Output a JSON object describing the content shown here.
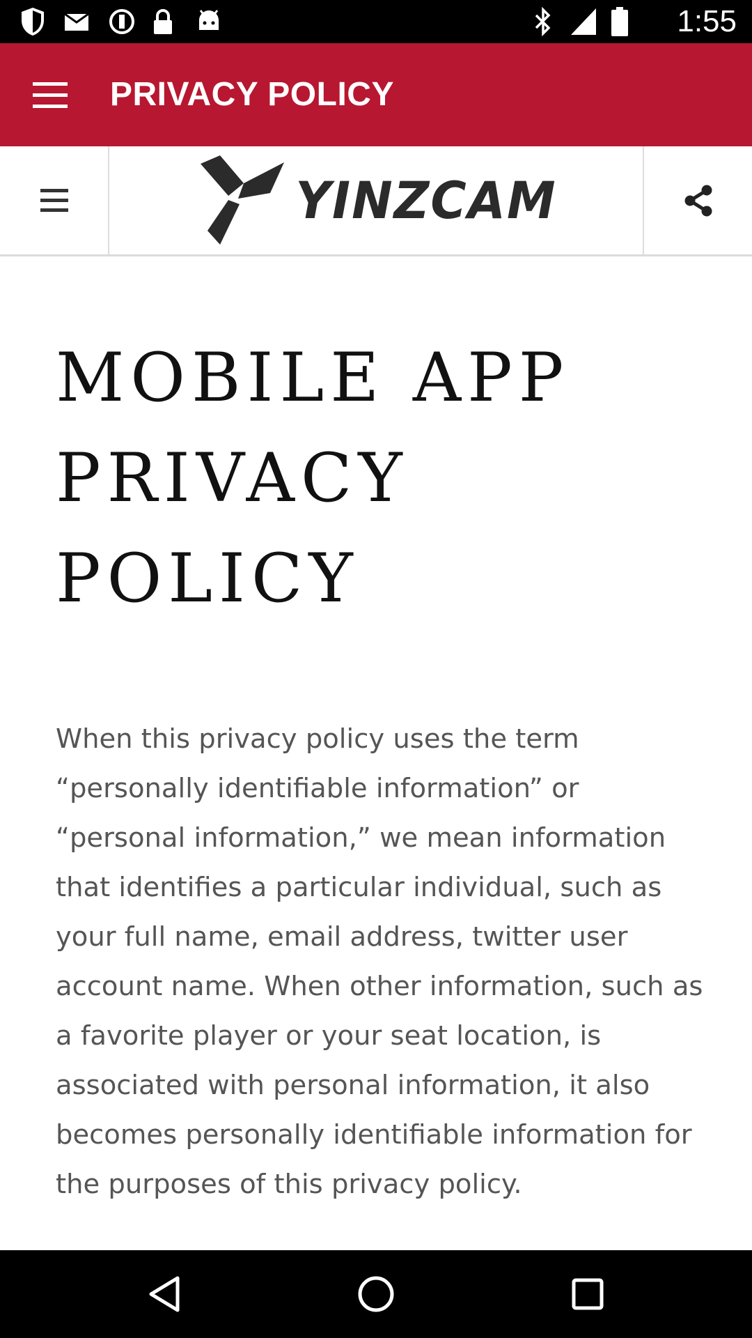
{
  "status_bar": {
    "time": "1:55",
    "icons": [
      "shield-notification-icon",
      "mail-icon",
      "alert-circle-icon",
      "lock-icon",
      "android-icon",
      "bluetooth-icon",
      "signal-icon",
      "battery-icon"
    ]
  },
  "app_bar": {
    "title": "PRIVACY POLICY",
    "color": "#b71730"
  },
  "web_header": {
    "logo_text": "YINZCAM"
  },
  "content": {
    "title": "MOBILE APP PRIVACY POLICY",
    "body": "When this privacy policy uses the term “personally identifiable information” or “personal information,” we mean information that identifies a particular individual, such as your full name, email address, twitter user account name. When other information, such as a favorite player or your seat location, is associated with personal information, it also becomes personally identifiable information for the purposes of this privacy policy."
  },
  "nav_bar": {
    "buttons": [
      "back-icon",
      "home-icon",
      "recents-icon"
    ]
  }
}
